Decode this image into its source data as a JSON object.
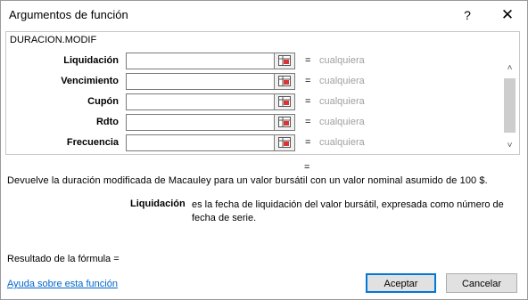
{
  "dialog": {
    "title": "Argumentos de función",
    "help_glyph": "?",
    "close_glyph": "✕"
  },
  "function_name": "DURACION.MODIF",
  "arguments": [
    {
      "label": "Liquidación",
      "value": "",
      "equals": "=",
      "result": "cualquiera"
    },
    {
      "label": "Vencimiento",
      "value": "",
      "equals": "=",
      "result": "cualquiera"
    },
    {
      "label": "Cupón",
      "value": "",
      "equals": "=",
      "result": "cualquiera"
    },
    {
      "label": "Rdto",
      "value": "",
      "equals": "=",
      "result": "cualquiera"
    },
    {
      "label": "Frecuencia",
      "value": "",
      "equals": "=",
      "result": "cualquiera"
    }
  ],
  "scrollbar": {
    "up_glyph": "˄",
    "down_glyph": "˅"
  },
  "result_equals": "=",
  "description": "Devuelve la duración modificada de Macauley para un valor bursátil con un valor nominal asumido de 100 $.",
  "argument_detail": {
    "label": "Liquidación",
    "text": "es la fecha de liquidación del valor bursátil, expresada como número de fecha de serie."
  },
  "formula_result": "Resultado de la fórmula =",
  "help_link": "Ayuda sobre esta función",
  "buttons": {
    "ok": "Aceptar",
    "cancel": "Cancelar"
  },
  "icons": {
    "range_select": "range-select-icon"
  }
}
